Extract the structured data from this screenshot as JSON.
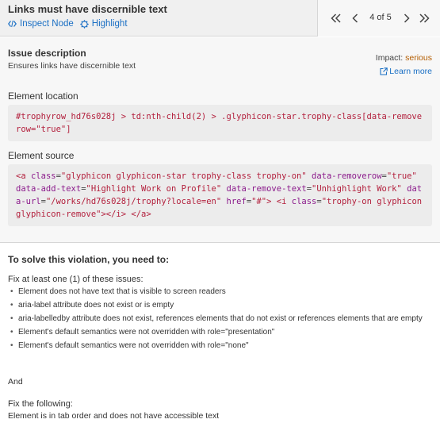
{
  "header": {
    "title": "Links must have discernible text",
    "inspect_label": "Inspect Node",
    "highlight_label": "Highlight"
  },
  "pager": {
    "count_text": "4 of 5"
  },
  "issue": {
    "title": "Issue description",
    "text": "Ensures links have discernible text",
    "impact_label": "Impact:",
    "impact_value": "serious",
    "learn_more": "Learn more",
    "colors": {
      "impact": "#b35c00",
      "link": "#1a6fc4"
    }
  },
  "location": {
    "label": "Element location",
    "selector": "#trophyrow_hd76s028j > td:nth-child(2) > .glyphicon-star.trophy-class[data-removerow=\"true\"]"
  },
  "source": {
    "label": "Element source",
    "code": {
      "open_tag": "<a",
      "class_attr": "class",
      "class_val": "\"glyphicon glyphicon-star trophy-class trophy-on\"",
      "removerow_attr": "data-removerow",
      "removerow_val": "\"true\"",
      "addtext_attr": "data-add-text",
      "addtext_val": "\"Highlight Work on Profile\"",
      "removetext_attr": "data-remove-text",
      "removetext_val": "\"Unhighlight Work\"",
      "url_attr": "data-url",
      "url_val": "\"/works/hd76s028j/trophy?locale=en\"",
      "href_attr": "href",
      "href_val": "\"#\"",
      "close_bracket": ">",
      "i_open": "<i",
      "i_class_attr": "class",
      "i_class_val": "\"trophy-on glyphicon glyphicon-remove\"",
      "i_close": "></i>",
      "a_close": "</a>"
    }
  },
  "fix": {
    "title": "To solve this violation, you need to:",
    "any_heading": "Fix at least one (1) of these issues:",
    "any_items": [
      "Element does not have text that is visible to screen readers",
      "aria-label attribute does not exist or is empty",
      "aria-labelledby attribute does not exist, references elements that do not exist or references elements that are empty",
      "Element's default semantics were not overridden with role=\"presentation\"",
      "Element's default semantics were not overridden with role=\"none\""
    ],
    "and_text": "And",
    "all_heading": "Fix the following:",
    "all_item": "Element is in tab order and does not have accessible text"
  }
}
